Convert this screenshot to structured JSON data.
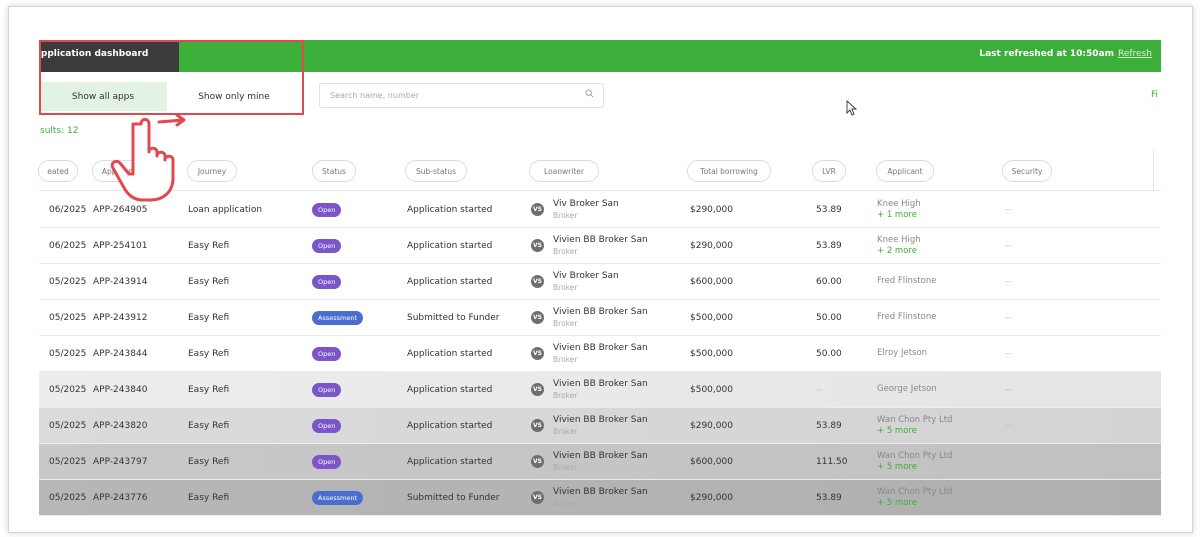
{
  "header": {
    "app_title": "Application dashboard",
    "app_title_visible": " pplication dashboard",
    "last_refreshed": "Last refreshed at 10:50am",
    "refresh_link": "Refresh"
  },
  "filters": {
    "show_all": "Show all apps",
    "show_mine": "Show only mine",
    "search_placeholder": "Search name, number",
    "filter_link": "Fi",
    "results": "sults: 12"
  },
  "columns": [
    "eated",
    "App number",
    "Journey",
    "Status",
    "Sub-status",
    "Loanwriter",
    "Total borrowing",
    "LVR",
    "Applicant",
    "Security"
  ],
  "rows": [
    {
      "date": "06/2025",
      "app": "APP-264905",
      "journey": "Loan application",
      "status": "Open",
      "status_type": "open",
      "substatus": "Application started",
      "avatar": "VS",
      "lw_name": "Viv Broker San",
      "lw_role": "Broker",
      "borrowing": "$290,000",
      "lvr": "53.89",
      "applicant": "Knee High",
      "more": "+ 1 more",
      "security": "--"
    },
    {
      "date": "06/2025",
      "app": "APP-254101",
      "journey": "Easy Refi",
      "status": "Open",
      "status_type": "open",
      "substatus": "Application started",
      "avatar": "VS",
      "lw_name": "Vivien BB Broker San",
      "lw_role": "Broker",
      "borrowing": "$290,000",
      "lvr": "53.89",
      "applicant": "Knee High",
      "more": "+ 2 more",
      "security": "--"
    },
    {
      "date": "05/2025",
      "app": "APP-243914",
      "journey": "Easy Refi",
      "status": "Open",
      "status_type": "open",
      "substatus": "Application started",
      "avatar": "VS",
      "lw_name": "Viv Broker San",
      "lw_role": "Broker",
      "borrowing": "$600,000",
      "lvr": "60.00",
      "applicant": "Fred Flinstone",
      "more": "",
      "security": "--"
    },
    {
      "date": "05/2025",
      "app": "APP-243912",
      "journey": "Easy Refi",
      "status": "Assessment",
      "status_type": "assess",
      "substatus": "Submitted to Funder",
      "avatar": "VS",
      "lw_name": "Vivien BB Broker San",
      "lw_role": "Broker",
      "borrowing": "$500,000",
      "lvr": "50.00",
      "applicant": "Fred Flinstone",
      "more": "",
      "security": "--"
    },
    {
      "date": "05/2025",
      "app": "APP-243844",
      "journey": "Easy Refi",
      "status": "Open",
      "status_type": "open",
      "substatus": "Application started",
      "avatar": "VS",
      "lw_name": "Vivien BB Broker San",
      "lw_role": "Broker",
      "borrowing": "$500,000",
      "lvr": "50.00",
      "applicant": "Elroy Jetson",
      "more": "",
      "security": "--"
    },
    {
      "date": "05/2025",
      "app": "APP-243840",
      "journey": "Easy Refi",
      "status": "Open",
      "status_type": "open",
      "substatus": "Application started",
      "avatar": "VS",
      "lw_name": "Vivien BB Broker San",
      "lw_role": "Broker",
      "borrowing": "$500,000",
      "lvr": "--",
      "applicant": "George Jetson",
      "more": "",
      "security": "--"
    },
    {
      "date": "05/2025",
      "app": "APP-243820",
      "journey": "Easy Refi",
      "status": "Open",
      "status_type": "open",
      "substatus": "Application started",
      "avatar": "VS",
      "lw_name": "Vivien BB Broker San",
      "lw_role": "Broker",
      "borrowing": "$290,000",
      "lvr": "53.89",
      "applicant": "Wan Chon Pty Ltd",
      "more": "+ 5 more",
      "security": "--"
    },
    {
      "date": "05/2025",
      "app": "APP-243797",
      "journey": "Easy Refi",
      "status": "Open",
      "status_type": "open",
      "substatus": "Application started",
      "avatar": "VS",
      "lw_name": "Vivien BB Broker San",
      "lw_role": "Broker",
      "borrowing": "$600,000",
      "lvr": "111.50",
      "applicant": "Wan Chon Pty Ltd",
      "more": "+ 5 more",
      "security": "--"
    },
    {
      "date": "05/2025",
      "app": "APP-243776",
      "journey": "Easy Refi",
      "status": "Assessment",
      "status_type": "assess",
      "substatus": "Submitted to Funder",
      "avatar": "VS",
      "lw_name": "Vivien BB Broker San",
      "lw_role": "Broker",
      "borrowing": "$290,000",
      "lvr": "53.89",
      "applicant": "Wan Chon Pty Ltd",
      "more": "+ 5 more",
      "security": "--"
    }
  ],
  "colors": {
    "brand_green": "#3cae3a",
    "header_dark": "#3b3b3b",
    "annotation_red": "#e14850",
    "badge_open": "#7b55c9",
    "badge_assessment": "#4a6ed0"
  }
}
